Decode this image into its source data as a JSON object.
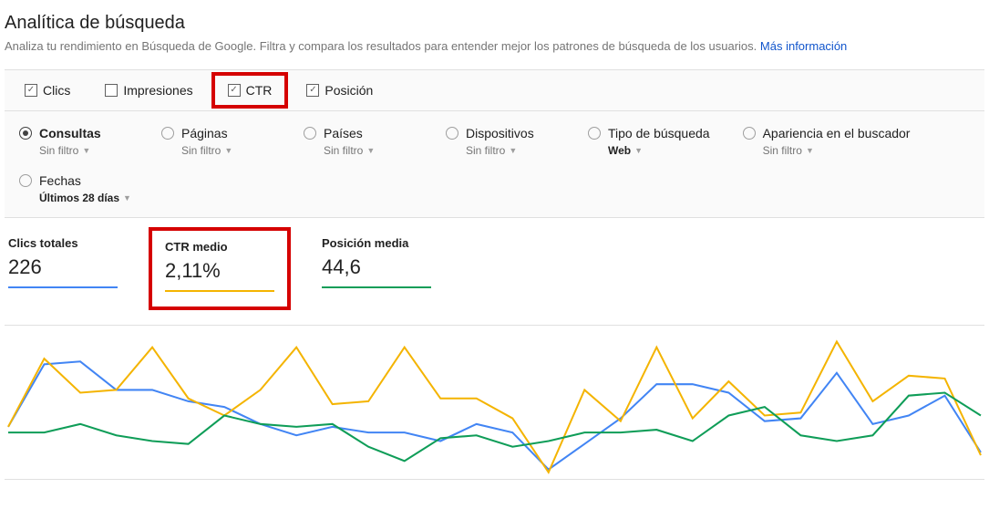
{
  "page": {
    "title": "Analítica de búsqueda",
    "subtitle": "Analiza tu rendimiento en Búsqueda de Google. Filtra y compara los resultados para entender mejor los patrones de búsqueda de los usuarios.",
    "more_info": "Más información"
  },
  "metrics": {
    "clics": {
      "label": "Clics",
      "checked": true
    },
    "impresiones": {
      "label": "Impresiones",
      "checked": false
    },
    "ctr": {
      "label": "CTR",
      "checked": true
    },
    "posicion": {
      "label": "Posición",
      "checked": true
    }
  },
  "dimensions": {
    "consultas": {
      "label": "Consultas",
      "sub": "Sin filtro",
      "selected": true
    },
    "paginas": {
      "label": "Páginas",
      "sub": "Sin filtro",
      "selected": false
    },
    "paises": {
      "label": "Países",
      "sub": "Sin filtro",
      "selected": false
    },
    "dispositivos": {
      "label": "Dispositivos",
      "sub": "Sin filtro",
      "selected": false
    },
    "tipo": {
      "label": "Tipo de búsqueda",
      "sub": "Web",
      "selected": false,
      "sub_strong": true
    },
    "apariencia": {
      "label": "Apariencia en el buscador",
      "sub": "Sin filtro",
      "selected": false
    },
    "fechas": {
      "label": "Fechas",
      "sub": "Últimos 28 días",
      "selected": false,
      "sub_strong": true
    }
  },
  "stats": {
    "clics": {
      "label": "Clics totales",
      "value": "226",
      "color": "blue"
    },
    "ctr": {
      "label": "CTR medio",
      "value": "2,11%",
      "color": "orange"
    },
    "posicion": {
      "label": "Posición media",
      "value": "44,6",
      "color": "green"
    }
  },
  "chart_data": {
    "type": "line",
    "title": "",
    "xlabel": "",
    "ylabel": "",
    "x": [
      1,
      2,
      3,
      4,
      5,
      6,
      7,
      8,
      9,
      10,
      11,
      12,
      13,
      14,
      15,
      16,
      17,
      18,
      19,
      20,
      21,
      22,
      23,
      24,
      25,
      26,
      27,
      28
    ],
    "ylim": [
      0,
      100
    ],
    "series": [
      {
        "name": "Clics",
        "color": "#4285f4",
        "values": [
          34,
          78,
          80,
          60,
          60,
          52,
          48,
          36,
          28,
          34,
          30,
          30,
          24,
          36,
          30,
          4,
          22,
          40,
          64,
          64,
          58,
          38,
          40,
          72,
          36,
          42,
          56,
          16
        ]
      },
      {
        "name": "CTR",
        "color": "#f4b400",
        "values": [
          34,
          82,
          58,
          60,
          90,
          54,
          42,
          60,
          90,
          50,
          52,
          90,
          54,
          54,
          40,
          2,
          60,
          38,
          90,
          40,
          66,
          42,
          44,
          94,
          52,
          70,
          68,
          14
        ]
      },
      {
        "name": "Posición",
        "color": "#0f9d58",
        "values": [
          30,
          30,
          36,
          28,
          24,
          22,
          42,
          36,
          34,
          36,
          20,
          10,
          26,
          28,
          20,
          24,
          30,
          30,
          32,
          24,
          42,
          48,
          28,
          24,
          28,
          56,
          58,
          42
        ]
      }
    ]
  }
}
